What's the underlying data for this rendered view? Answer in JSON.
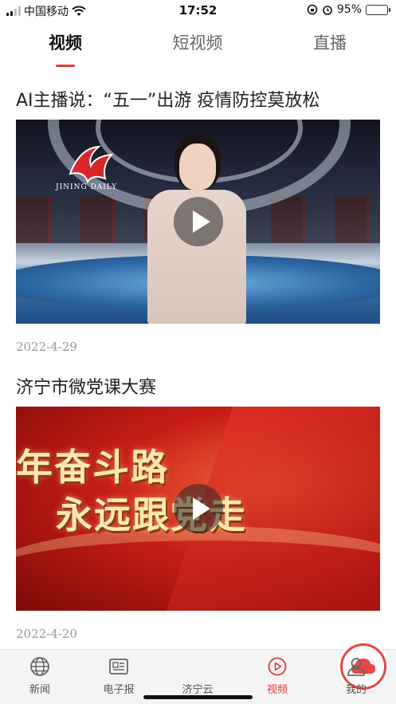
{
  "status_bar": {
    "carrier": "中国移动",
    "time": "17:52",
    "battery_percent": "95%"
  },
  "top_tabs": [
    {
      "label": "视频",
      "active": true
    },
    {
      "label": "短视频",
      "active": false
    },
    {
      "label": "直播",
      "active": false
    }
  ],
  "feed": [
    {
      "title": "AI主播说：“五一”出游 疫情防控莫放松",
      "date": "2022-4-29",
      "thumb_logo_text": "JINING DAILY"
    },
    {
      "title": "济宁市微党课大赛",
      "date": "2022-4-20",
      "thumb_line1": "年奋斗路",
      "thumb_line2": "永远跟党走"
    }
  ],
  "bottom_nav": [
    {
      "label": "新闻",
      "icon": "globe-icon"
    },
    {
      "label": "电子报",
      "icon": "newspaper-icon"
    },
    {
      "label": "济宁云",
      "icon": "cloud-icon"
    },
    {
      "label": "视频",
      "icon": "play-circle-icon",
      "active": true
    },
    {
      "label": "我的",
      "icon": "user-icon"
    }
  ],
  "colors": {
    "accent": "#e33a3a",
    "battery": "#34c759"
  },
  "battery_level": 0.95
}
